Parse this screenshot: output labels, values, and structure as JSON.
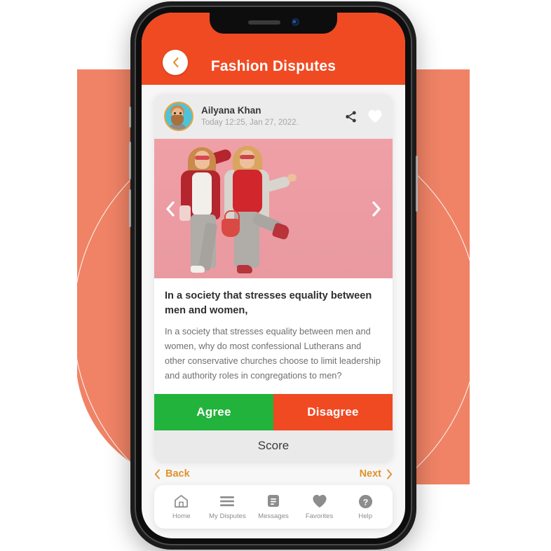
{
  "header": {
    "title": "Fashion Disputes",
    "back_icon": "chevron-left-icon",
    "background_color": "#F04A23"
  },
  "post": {
    "user_name": "Ailyana Khan",
    "timestamp": "Today  12:25, Jan 27, 2022.",
    "share_icon": "share-icon",
    "favorite_icon": "heart-icon",
    "avatar_icon": "avatar"
  },
  "carousel": {
    "prev_icon": "chevron-left-icon",
    "next_icon": "chevron-right-icon"
  },
  "content": {
    "title": "In a society that stresses equality between men and women,",
    "body": "In a society that stresses equality between men and women, why do most confessional Lutherans and other conservative churches choose to limit leadership and authority roles in congregations to men?"
  },
  "actions": {
    "agree_label": "Agree",
    "disagree_label": "Disagree",
    "score_label": "Score",
    "agree_color": "#22B33C",
    "disagree_color": "#F04A23"
  },
  "pager": {
    "back_label": "Back",
    "next_label": "Next",
    "back_icon": "chevron-left-icon",
    "next_icon": "chevron-right-icon",
    "accent_color": "#E09230"
  },
  "bottom_nav": {
    "items": [
      {
        "label": "Home",
        "icon": "home-icon"
      },
      {
        "label": "My Disputes",
        "icon": "menu-lines-icon"
      },
      {
        "label": "Messages",
        "icon": "message-icon"
      },
      {
        "label": "Favorites",
        "icon": "heart-icon"
      },
      {
        "label": "Help",
        "icon": "question-circle-icon"
      }
    ]
  },
  "decor": {
    "panel_color": "#F08366",
    "arc_color": "#FFFFFF"
  }
}
